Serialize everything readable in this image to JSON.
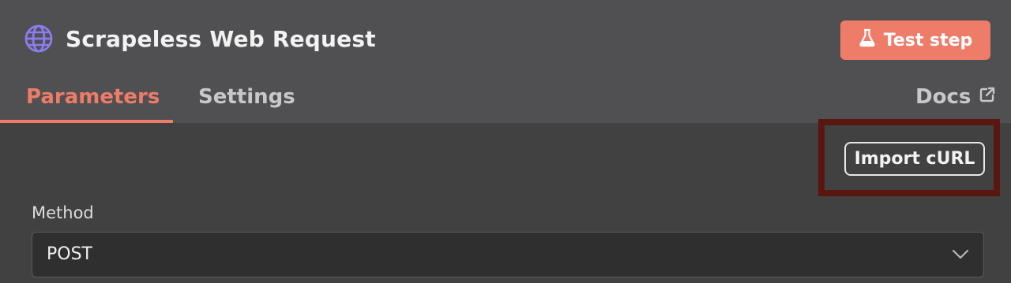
{
  "header": {
    "title": "Scrapeless Web Request",
    "title_icon": "globe-icon",
    "test_button_label": "Test step",
    "test_button_icon": "flask-icon"
  },
  "tabs": [
    {
      "label": "Parameters",
      "active": true
    },
    {
      "label": "Settings",
      "active": false
    }
  ],
  "docs": {
    "label": "Docs",
    "icon": "external-link-icon"
  },
  "toolbar": {
    "import_curl_label": "Import cURL"
  },
  "method": {
    "label": "Method",
    "value": "POST",
    "icon": "chevron-down-icon"
  },
  "colors": {
    "accent": "#ee7c68",
    "header_bg": "#505052",
    "panel_bg": "#414142",
    "highlight_border": "#5a1710",
    "globe": "#8b7cf0"
  }
}
